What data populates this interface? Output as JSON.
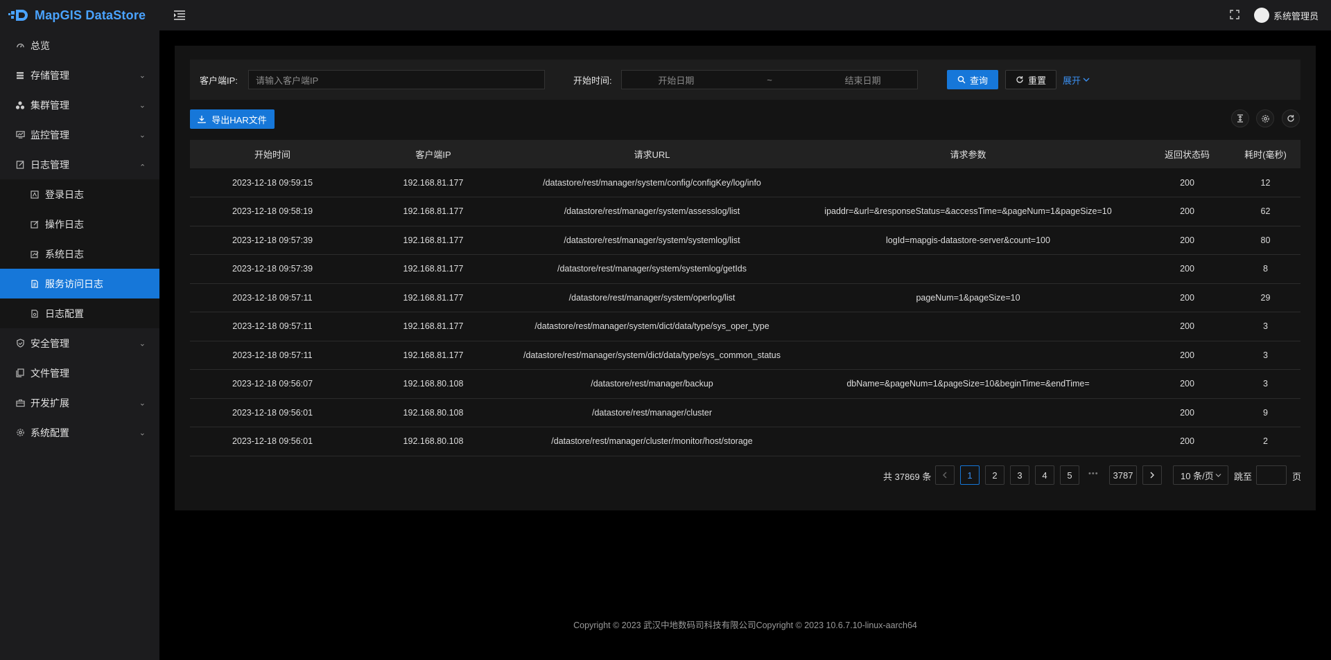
{
  "app": {
    "name": "MapGIS DataStore",
    "user": "系统管理员"
  },
  "sidebar": {
    "items": [
      {
        "label": "总览",
        "icon": "dashboard-icon"
      },
      {
        "label": "存储管理",
        "icon": "storage-icon"
      },
      {
        "label": "集群管理",
        "icon": "cluster-icon"
      },
      {
        "label": "监控管理",
        "icon": "monitor-icon"
      },
      {
        "label": "日志管理",
        "icon": "log-icon"
      },
      {
        "label": "安全管理",
        "icon": "shield-icon"
      },
      {
        "label": "文件管理",
        "icon": "file-icon"
      },
      {
        "label": "开发扩展",
        "icon": "briefcase-icon"
      },
      {
        "label": "系统配置",
        "icon": "gear-icon"
      }
    ],
    "log_sub": [
      {
        "label": "登录日志",
        "icon": "login-log-icon"
      },
      {
        "label": "操作日志",
        "icon": "edit-log-icon"
      },
      {
        "label": "系统日志",
        "icon": "system-log-icon"
      },
      {
        "label": "服务访问日志",
        "icon": "service-log-icon"
      },
      {
        "label": "日志配置",
        "icon": "config-log-icon"
      }
    ]
  },
  "search": {
    "client_ip_label": "客户端IP:",
    "client_ip_placeholder": "请输入客户端IP",
    "time_label": "开始时间:",
    "start_placeholder": "开始日期",
    "range_sep": "~",
    "end_placeholder": "结束日期",
    "query_label": "查询",
    "reset_label": "重置",
    "expand_label": "展开"
  },
  "toolbar": {
    "export_label": "导出HAR文件"
  },
  "table": {
    "headers": [
      "开始时间",
      "客户端IP",
      "请求URL",
      "请求参数",
      "返回状态码",
      "耗时(毫秒)"
    ],
    "rows": [
      [
        "2023-12-18 09:59:15",
        "192.168.81.177",
        "/datastore/rest/manager/system/config/configKey/log/info",
        "",
        "200",
        "12"
      ],
      [
        "2023-12-18 09:58:19",
        "192.168.81.177",
        "/datastore/rest/manager/system/assesslog/list",
        "ipaddr=&url=&responseStatus=&accessTime=&pageNum=1&pageSize=10",
        "200",
        "62"
      ],
      [
        "2023-12-18 09:57:39",
        "192.168.81.177",
        "/datastore/rest/manager/system/systemlog/list",
        "logId=mapgis-datastore-server&count=100",
        "200",
        "80"
      ],
      [
        "2023-12-18 09:57:39",
        "192.168.81.177",
        "/datastore/rest/manager/system/systemlog/getIds",
        "",
        "200",
        "8"
      ],
      [
        "2023-12-18 09:57:11",
        "192.168.81.177",
        "/datastore/rest/manager/system/operlog/list",
        "pageNum=1&pageSize=10",
        "200",
        "29"
      ],
      [
        "2023-12-18 09:57:11",
        "192.168.81.177",
        "/datastore/rest/manager/system/dict/data/type/sys_oper_type",
        "",
        "200",
        "3"
      ],
      [
        "2023-12-18 09:57:11",
        "192.168.81.177",
        "/datastore/rest/manager/system/dict/data/type/sys_common_status",
        "",
        "200",
        "3"
      ],
      [
        "2023-12-18 09:56:07",
        "192.168.80.108",
        "/datastore/rest/manager/backup",
        "dbName=&pageNum=1&pageSize=10&beginTime=&endTime=",
        "200",
        "3"
      ],
      [
        "2023-12-18 09:56:01",
        "192.168.80.108",
        "/datastore/rest/manager/cluster",
        "",
        "200",
        "9"
      ],
      [
        "2023-12-18 09:56:01",
        "192.168.80.108",
        "/datastore/rest/manager/cluster/monitor/host/storage",
        "",
        "200",
        "2"
      ]
    ]
  },
  "pagination": {
    "total": "共 37869 条",
    "pages": [
      "1",
      "2",
      "3",
      "4",
      "5"
    ],
    "ellipsis": "•••",
    "last": "3787",
    "page_size": "10 条/页",
    "jump_label": "跳至",
    "page_suffix": "页",
    "current": "1"
  },
  "footer": "Copyright © 2023 武汉中地数码司科技有限公司Copyright © 2023 10.6.7.10-linux-aarch64",
  "colors": {
    "accent": "#1677d9",
    "sidebar_bg": "#1c1c1e",
    "panel_bg": "#141414"
  }
}
